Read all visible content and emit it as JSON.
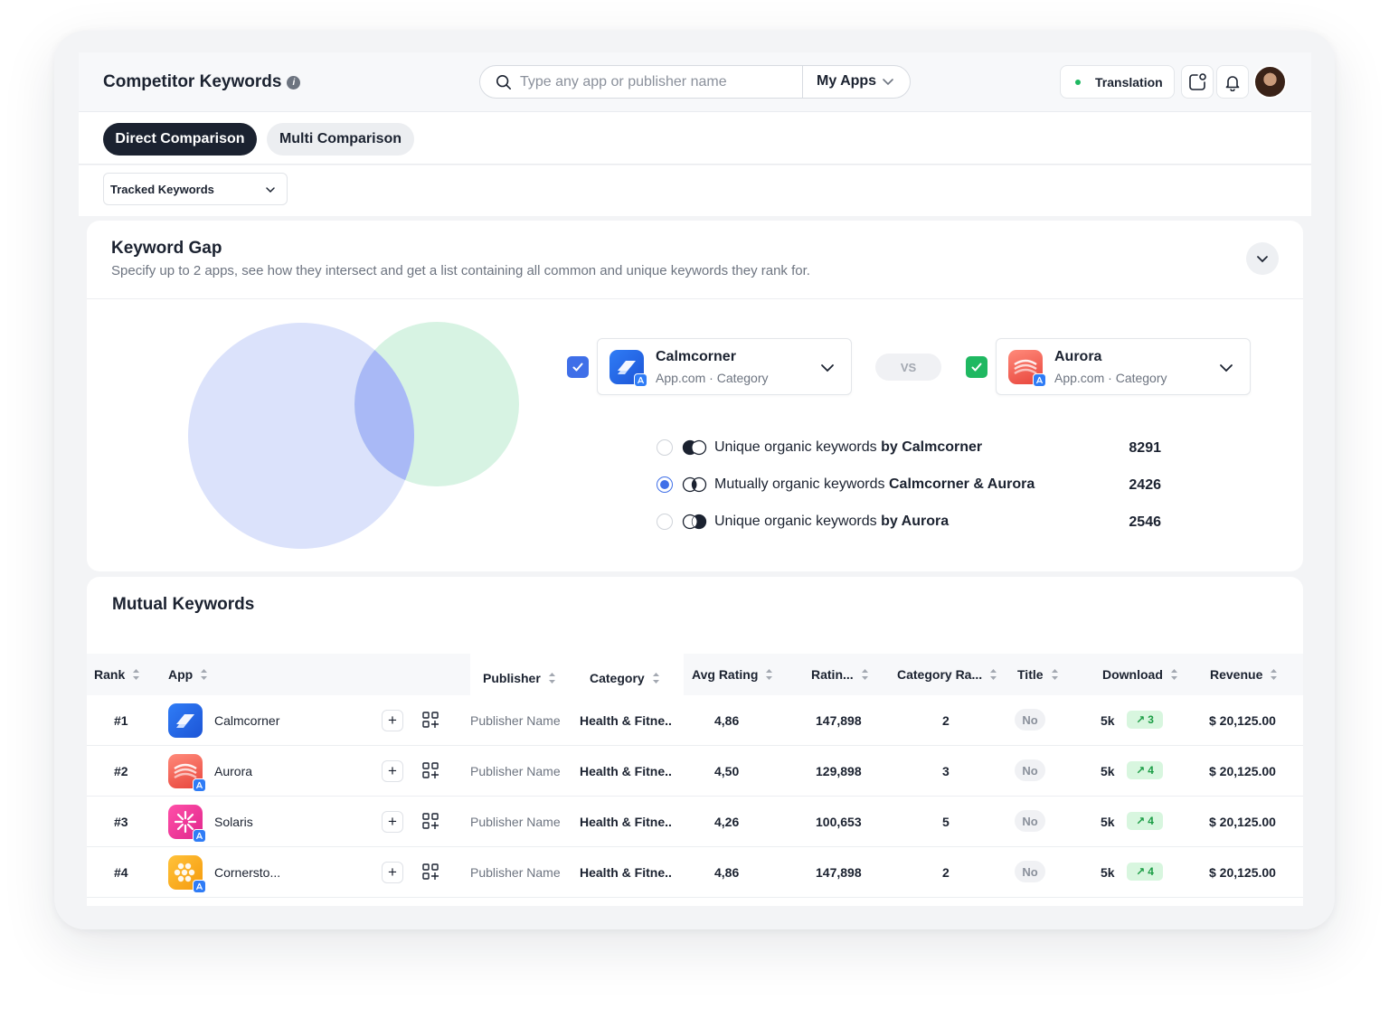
{
  "header": {
    "title": "Competitor Keywords",
    "search_placeholder": "Type any app or publisher name",
    "scope_label": "My Apps",
    "translation_label": "Translation"
  },
  "tabs": [
    {
      "label": "Direct Comparison",
      "active": true
    },
    {
      "label": "Multi Comparison",
      "active": false
    }
  ],
  "filter": {
    "label": "Tracked Keywords"
  },
  "keyword_gap": {
    "title": "Keyword Gap",
    "subtitle": "Specify up to 2 apps, see how they intersect and get a list containing all common and unique keywords they rank for.",
    "app_a": {
      "name": "Calmcorner",
      "domain": "App.com",
      "category": "Category",
      "checked": true,
      "check_color": "#3f6fe8"
    },
    "app_b": {
      "name": "Aurora",
      "domain": "App.com",
      "category": "Category",
      "checked": true,
      "check_color": "#1fb861"
    },
    "vs_label": "VS",
    "venn_colors": {
      "a": "#dbe2fb",
      "b": "#d7f3e3",
      "overlap": "#a9b9f6"
    },
    "rows": [
      {
        "prefix": "Unique organic keywords",
        "bold": "by Calmcorner",
        "count": "8291",
        "selected": false
      },
      {
        "prefix": "Mutually organic keywords",
        "bold": "Calmcorner & Aurora",
        "count": "2426",
        "selected": true
      },
      {
        "prefix": "Unique organic keywords",
        "bold": "by Aurora",
        "count": "2546",
        "selected": false
      }
    ]
  },
  "mutual": {
    "title": "Mutual Keywords",
    "columns": [
      "Rank",
      "App",
      "Publisher",
      "Category",
      "Avg Rating",
      "Ratin...",
      "Category Ra...",
      "Title",
      "Download",
      "Revenue"
    ],
    "rows": [
      {
        "rank": "#1",
        "app": "Calmcorner",
        "icon": "calmcorner-icon",
        "publisher": "Publisher Name",
        "category": "Health & Fitne..",
        "avg_rating": "4,86",
        "ratings": "147,898",
        "category_rank": "2",
        "title": "No",
        "download": "5k",
        "trend": "3",
        "revenue": "$ 20,125.00"
      },
      {
        "rank": "#2",
        "app": "Aurora",
        "icon": "aurora-icon",
        "publisher": "Publisher Name",
        "category": "Health & Fitne..",
        "avg_rating": "4,50",
        "ratings": "129,898",
        "category_rank": "3",
        "title": "No",
        "download": "5k",
        "trend": "4",
        "revenue": "$ 20,125.00"
      },
      {
        "rank": "#3",
        "app": "Solaris",
        "icon": "solaris-icon",
        "publisher": "Publisher Name",
        "category": "Health & Fitne..",
        "avg_rating": "4,26",
        "ratings": "100,653",
        "category_rank": "5",
        "title": "No",
        "download": "5k",
        "trend": "4",
        "revenue": "$ 20,125.00"
      },
      {
        "rank": "#4",
        "app": "Cornersto...",
        "icon": "cornerstone-icon",
        "publisher": "Publisher Name",
        "category": "Health & Fitne..",
        "avg_rating": "4,86",
        "ratings": "147,898",
        "category_rank": "2",
        "title": "No",
        "download": "5k",
        "trend": "4",
        "revenue": "$ 20,125.00"
      }
    ]
  }
}
